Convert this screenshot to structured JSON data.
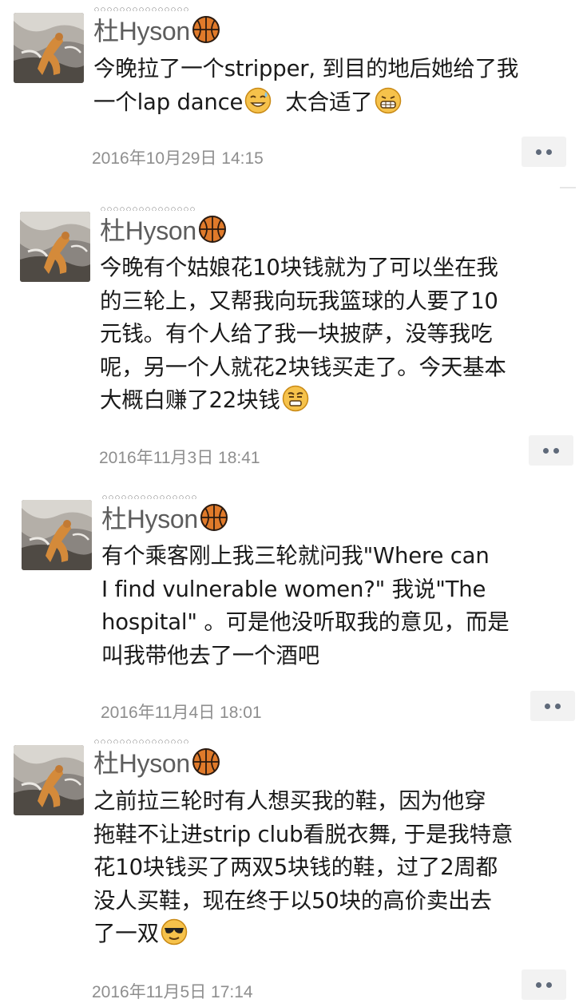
{
  "posts": [
    {
      "author": "杜Hyson",
      "lines": [
        "今晚拉了一个stripper, 到目的地后她给了我",
        "一个lap dance",
        "太合适了"
      ],
      "timestamp": "2016年10月29日 14:15"
    },
    {
      "author": "杜Hyson",
      "lines": [
        "今晚有个姑娘花10块钱就为了可以坐在我",
        "的三轮上，又帮我向玩我篮球的人要了10",
        "元钱。有个人给了我一块披萨，没等我吃",
        "呢，另一个人就花2块钱买走了。今天基本",
        "大概白赚了22块钱"
      ],
      "timestamp": "2016年11月3日 18:41"
    },
    {
      "author": "杜Hyson",
      "lines": [
        "有个乘客刚上我三轮就问我\"Where can",
        "I find vulnerable women?\" 我说\"The",
        "hospital\" 。可是他没听取我的意见，而是",
        "叫我带他去了一个酒吧"
      ],
      "timestamp": "2016年11月4日 18:01"
    },
    {
      "author": "杜Hyson",
      "lines": [
        "之前拉三轮时有人想买我的鞋，因为他穿",
        "拖鞋不让进strip club看脱衣舞, 于是我特意",
        "花10块钱买了两双5块钱的鞋，过了2周都",
        "没人买鞋，现在终于以50块的高价卖出去",
        "了一双"
      ],
      "timestamp": "2016年11月5日 17:14"
    }
  ],
  "icons": {
    "author_badge": "basketball-icon",
    "more": "more-dots-icon",
    "post1_emoji_a": "sweat-smile-emoji-icon",
    "post1_emoji_b": "grin-emoji-icon",
    "post2_emoji": "smirk-emoji-icon",
    "post4_emoji": "sunglasses-emoji-icon"
  },
  "colors": {
    "name": "#5d5d5d",
    "text": "#1a1a1a",
    "timestamp": "#8e8e8e",
    "more_bg": "#f2f2f2",
    "dot": "#5f6a7a",
    "basketball": "#e07a2a"
  }
}
